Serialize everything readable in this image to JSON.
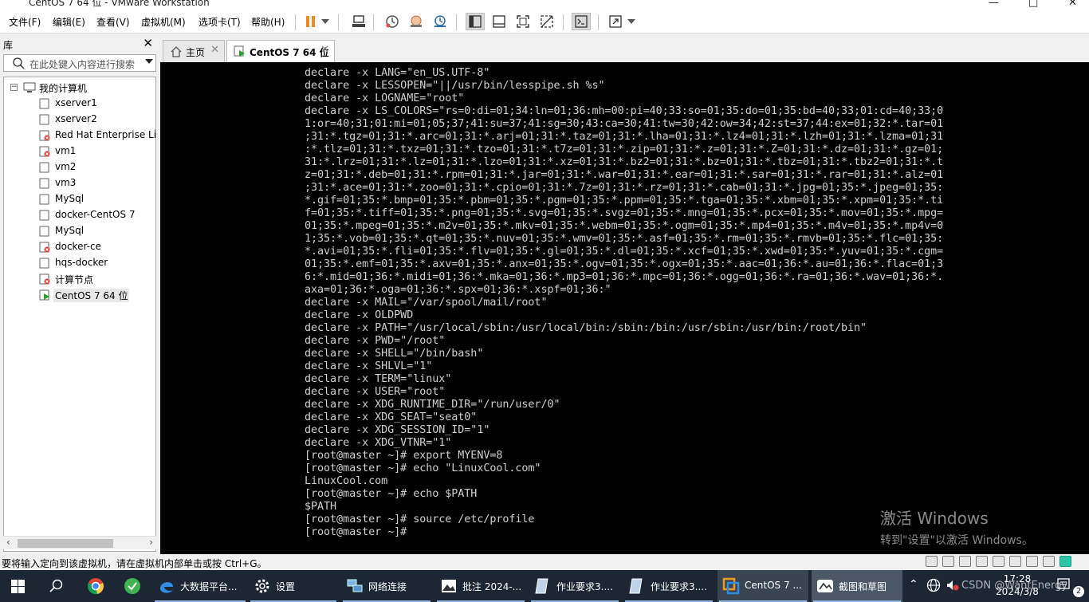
{
  "window": {
    "title": "CentOS 7 64 位 - VMware Workstation"
  },
  "menu": {
    "items": [
      "文件(F)",
      "编辑(E)",
      "查看(V)",
      "虚拟机(M)",
      "选项卡(T)",
      "帮助(H)"
    ]
  },
  "library": {
    "title": "库",
    "search_placeholder": "在此处键入内容进行搜索",
    "root": "我的计算机",
    "vms": [
      {
        "label": "xserver1",
        "icon": "vm-off-icon"
      },
      {
        "label": "xserver2",
        "icon": "vm-off-icon"
      },
      {
        "label": "Red Hat Enterprise Lin",
        "icon": "vm-error-icon"
      },
      {
        "label": "vm1",
        "icon": "vm-error-icon"
      },
      {
        "label": "vm2",
        "icon": "vm-off-icon"
      },
      {
        "label": "vm3",
        "icon": "vm-off-icon"
      },
      {
        "label": "MySql",
        "icon": "vm-off-icon"
      },
      {
        "label": "docker-CentOS 7",
        "icon": "vm-off-icon"
      },
      {
        "label": "MySql",
        "icon": "vm-off-icon"
      },
      {
        "label": "docker-ce",
        "icon": "vm-error-icon"
      },
      {
        "label": "hqs-docker",
        "icon": "vm-off-icon"
      },
      {
        "label": "计算节点",
        "icon": "vm-error-icon"
      },
      {
        "label": "CentOS 7 64 位",
        "icon": "vm-running-icon"
      }
    ]
  },
  "tabs": [
    {
      "label": "主页",
      "icon": "home-icon"
    },
    {
      "label": "CentOS 7 64 位",
      "icon": "vm-running-icon"
    }
  ],
  "terminal": {
    "lines": [
      "declare -x LANG=\"en_US.UTF-8\"",
      "declare -x LESSOPEN=\"||/usr/bin/lesspipe.sh %s\"",
      "declare -x LOGNAME=\"root\"",
      "declare -x LS_COLORS=\"rs=0:di=01;34:ln=01;36:mh=00:pi=40;33:so=01;35:do=01;35:bd=40;33;01:cd=40;33;0",
      "1:or=40;31;01:mi=01;05;37;41:su=37;41:sg=30;43:ca=30;41:tw=30;42:ow=34;42:st=37;44:ex=01;32:*.tar=01",
      ";31:*.tgz=01;31:*.arc=01;31:*.arj=01;31:*.taz=01;31:*.lha=01;31:*.lz4=01;31:*.lzh=01;31:*.lzma=01;31",
      ":*.tlz=01;31:*.txz=01;31:*.tzo=01;31:*.t7z=01;31:*.zip=01;31:*.z=01;31:*.Z=01;31:*.dz=01;31:*.gz=01;",
      "31:*.lrz=01;31:*.lz=01;31:*.lzo=01;31:*.xz=01;31:*.bz2=01;31:*.bz=01;31:*.tbz=01;31:*.tbz2=01;31:*.t",
      "z=01;31:*.deb=01;31:*.rpm=01;31:*.jar=01;31:*.war=01;31:*.ear=01;31:*.sar=01;31:*.rar=01;31:*.alz=01",
      ";31:*.ace=01;31:*.zoo=01;31:*.cpio=01;31:*.7z=01;31:*.rz=01;31:*.cab=01;31:*.jpg=01;35:*.jpeg=01;35:",
      "*.gif=01;35:*.bmp=01;35:*.pbm=01;35:*.pgm=01;35:*.ppm=01;35:*.tga=01;35:*.xbm=01;35:*.xpm=01;35:*.ti",
      "f=01;35:*.tiff=01;35:*.png=01;35:*.svg=01;35:*.svgz=01;35:*.mng=01;35:*.pcx=01;35:*.mov=01;35:*.mpg=",
      "01;35:*.mpeg=01;35:*.m2v=01;35:*.mkv=01;35:*.webm=01;35:*.ogm=01;35:*.mp4=01;35:*.m4v=01;35:*.mp4v=0",
      "1;35:*.vob=01;35:*.qt=01;35:*.nuv=01;35:*.wmv=01;35:*.asf=01;35:*.rm=01;35:*.rmvb=01;35:*.flc=01;35:",
      "*.avi=01;35:*.fli=01;35:*.flv=01;35:*.gl=01;35:*.dl=01;35:*.xcf=01;35:*.xwd=01;35:*.yuv=01;35:*.cgm=",
      "01;35:*.emf=01;35:*.axv=01;35:*.anx=01;35:*.ogv=01;35:*.ogx=01;35:*.aac=01;36:*.au=01;36:*.flac=01;3",
      "6:*.mid=01;36:*.midi=01;36:*.mka=01;36:*.mp3=01;36:*.mpc=01;36:*.ogg=01;36:*.ra=01;36:*.wav=01;36:*.",
      "axa=01;36:*.oga=01;36:*.spx=01;36:*.xspf=01;36:\"",
      "declare -x MAIL=\"/var/spool/mail/root\"",
      "declare -x OLDPWD",
      "declare -x PATH=\"/usr/local/sbin:/usr/local/bin:/sbin:/bin:/usr/sbin:/usr/bin:/root/bin\"",
      "declare -x PWD=\"/root\"",
      "declare -x SHELL=\"/bin/bash\"",
      "declare -x SHLVL=\"1\"",
      "declare -x TERM=\"linux\"",
      "declare -x USER=\"root\"",
      "declare -x XDG_RUNTIME_DIR=\"/run/user/0\"",
      "declare -x XDG_SEAT=\"seat0\"",
      "declare -x XDG_SESSION_ID=\"1\"",
      "declare -x XDG_VTNR=\"1\"",
      "[root@master ~]# export MYENV=8",
      "[root@master ~]# echo \"LinuxCool.com\"",
      "LinuxCool.com",
      "[root@master ~]# echo $PATH",
      "$PATH",
      "[root@master ~]# source /etc/profile",
      "[root@master ~]#"
    ]
  },
  "watermark": {
    "line1": "激活 Windows",
    "line2": "转到\"设置\"以激活 Windows。"
  },
  "statusbar": {
    "text": "要将输入定向到该虚拟机，请在虚拟机内部单击或按 Ctrl+G。"
  },
  "taskbar": {
    "apps": [
      {
        "label": "大数据平台...",
        "icon": "edge-icon"
      },
      {
        "label": "设置",
        "icon": "gear-icon"
      },
      {
        "label": "网络连接",
        "icon": "network-connections-icon"
      },
      {
        "label": "批注 2024-...",
        "icon": "image-icon"
      },
      {
        "label": "作业要求3....",
        "icon": "document-icon"
      },
      {
        "label": "作业要求3....",
        "icon": "document-icon"
      },
      {
        "label": "CentOS 7 ...",
        "icon": "vmware-icon"
      },
      {
        "label": "截图和草图",
        "icon": "snip-sketch-icon"
      }
    ],
    "time": "17:28",
    "date": "2024/3/8",
    "ime": "CSDN",
    "overlay": "CSDN @WantEnergy",
    "notification_count": "2"
  }
}
